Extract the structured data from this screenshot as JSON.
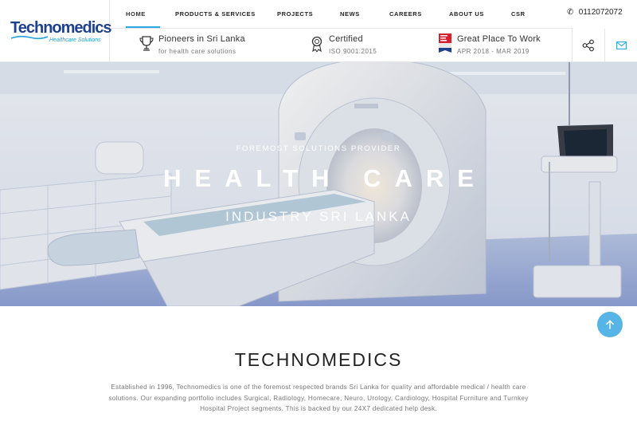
{
  "logo": {
    "name": "Technomedics",
    "tagline": "Healthcare Solutions"
  },
  "nav": {
    "items": [
      {
        "label": "HOME",
        "active": true
      },
      {
        "label": "PRODUCTS & SERVICES",
        "active": false
      },
      {
        "label": "PROJECTS",
        "active": false
      },
      {
        "label": "NEWS",
        "active": false
      },
      {
        "label": "CAREERS",
        "active": false
      },
      {
        "label": "ABOUT US",
        "active": false
      },
      {
        "label": "CSR",
        "active": false
      }
    ],
    "phone": "0112072072",
    "phone_icon": "phone-icon"
  },
  "highlights": [
    {
      "icon": "trophy-icon",
      "title": "Pioneers in Sri Lanka",
      "subtitle": "for health care solutions"
    },
    {
      "icon": "award-icon",
      "title": "Certified",
      "subtitle": "ISO 9001:2015"
    },
    {
      "icon": "great-place-badge-icon",
      "title": "Great Place To Work",
      "subtitle": "APR 2018 - MAR 2019"
    }
  ],
  "header_actions": [
    "share-icon",
    "mail-icon"
  ],
  "hero": {
    "kicker": "FOREMOST SOLUTIONS PROVIDER",
    "title": "HEALTH CARE",
    "subtitle": "INDUSTRY SRI LANKA",
    "image": "mri-scanner-room"
  },
  "about": {
    "title": "TECHNOMEDICS",
    "text": "Established in 1996, Technomedics is one of the foremost respected brands Sri Lanka for quality and affordable medical / health care solutions. Our expanding portfolio includes Surgical, Radiology, Homecare, Neuro, Urology, Cardiology, Hospital Furniture and Turnkey Hospital Project segments. This is backed by our 24X7 dedicated help desk."
  },
  "colors": {
    "accent": "#2aa7e6",
    "brand": "#1f3f8f",
    "scroll_button": "#56b4e6"
  }
}
